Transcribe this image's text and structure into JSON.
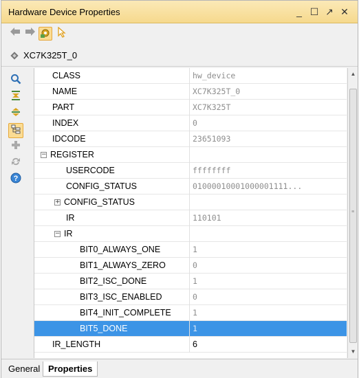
{
  "window": {
    "title": "Hardware Device Properties",
    "controls": {
      "minimize": "_",
      "maximize": "☐",
      "float": "↗",
      "close": "✕"
    }
  },
  "toolbar": {
    "back_icon": "back-arrow-icon",
    "forward_icon": "forward-arrow-icon",
    "settings_icon": "gear-icon",
    "select_icon": "pointer-icon"
  },
  "object": {
    "name": "XC7K325T_0",
    "icon": "chip-icon"
  },
  "sidebar": [
    "search-icon",
    "collapse-all-icon",
    "expand-all-icon",
    "group-icon",
    "add-icon",
    "refresh-icon",
    "help-icon"
  ],
  "rows": [
    {
      "name": "CLASS",
      "value": "hw_device"
    },
    {
      "name": "NAME",
      "value": "XC7K325T_0"
    },
    {
      "name": "PART",
      "value": "XC7K325T"
    },
    {
      "name": "INDEX",
      "value": "0"
    },
    {
      "name": "IDCODE",
      "value": "23651093"
    },
    {
      "name": "REGISTER",
      "value": "",
      "toggle": "⊟"
    },
    {
      "name": "USERCODE",
      "value": "ffffffff"
    },
    {
      "name": "CONFIG_STATUS",
      "value": "01000010001000001111..."
    },
    {
      "name": "CONFIG_STATUS",
      "value": "",
      "toggle": "⊞"
    },
    {
      "name": "IR",
      "value": "110101"
    },
    {
      "name": "IR",
      "value": "",
      "toggle": "⊟"
    },
    {
      "name": "BIT0_ALWAYS_ONE",
      "value": "1"
    },
    {
      "name": "BIT1_ALWAYS_ZERO",
      "value": "0"
    },
    {
      "name": "BIT2_ISC_DONE",
      "value": "1"
    },
    {
      "name": "BIT3_ISC_ENABLED",
      "value": "0"
    },
    {
      "name": "BIT4_INIT_COMPLETE",
      "value": "1"
    },
    {
      "name": "BIT5_DONE",
      "value": "1"
    },
    {
      "name": "IR_LENGTH",
      "value": "6"
    }
  ],
  "tabs": {
    "general": "General",
    "properties": "Properties"
  },
  "colors": {
    "title_bg": "#f6d98d",
    "selection": "#3c94e6",
    "accent": "#e5a83b"
  }
}
